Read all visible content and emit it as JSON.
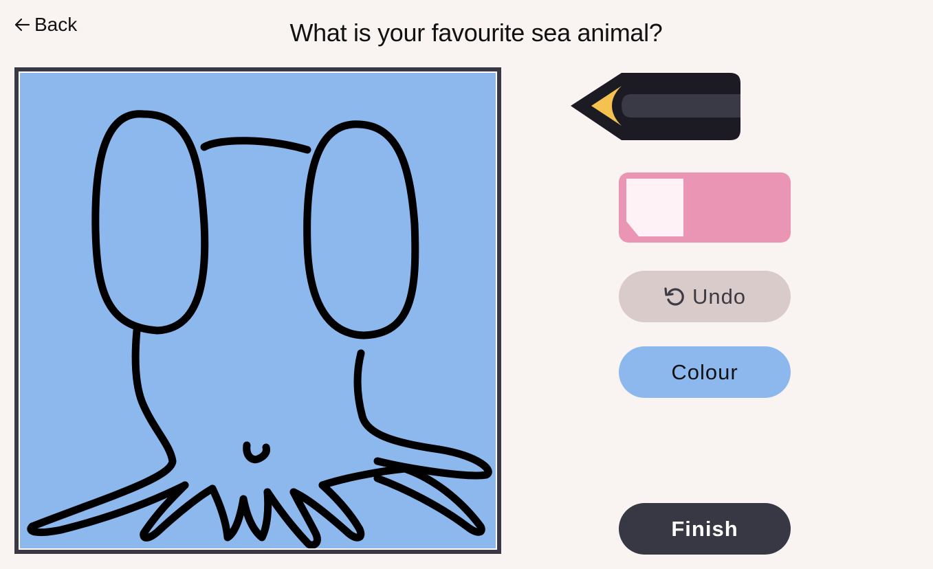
{
  "header": {
    "back_label": "Back",
    "title": "What is your favourite sea animal?"
  },
  "drawing": {
    "background_color": "#8cb8ee",
    "stroke_color": "#000000"
  },
  "tools": {
    "pencil_icon": "pencil-icon",
    "eraser_icon": "eraser-icon"
  },
  "buttons": {
    "undo_label": "Undo",
    "undo_icon": "undo-icon",
    "colour_label": "Colour",
    "finish_label": "Finish"
  },
  "colors": {
    "page_background": "#f9f3f2",
    "canvas_border": "#3a3845",
    "pencil_body": "#1c1b24",
    "pencil_stripe": "#3a3946",
    "pencil_tip": "#f5c24f",
    "eraser_pink": "#ea95b3",
    "eraser_light": "#fff2f6",
    "undo_background": "#d9cbca",
    "colour_background": "#8cb8ee",
    "finish_background": "#383744"
  }
}
